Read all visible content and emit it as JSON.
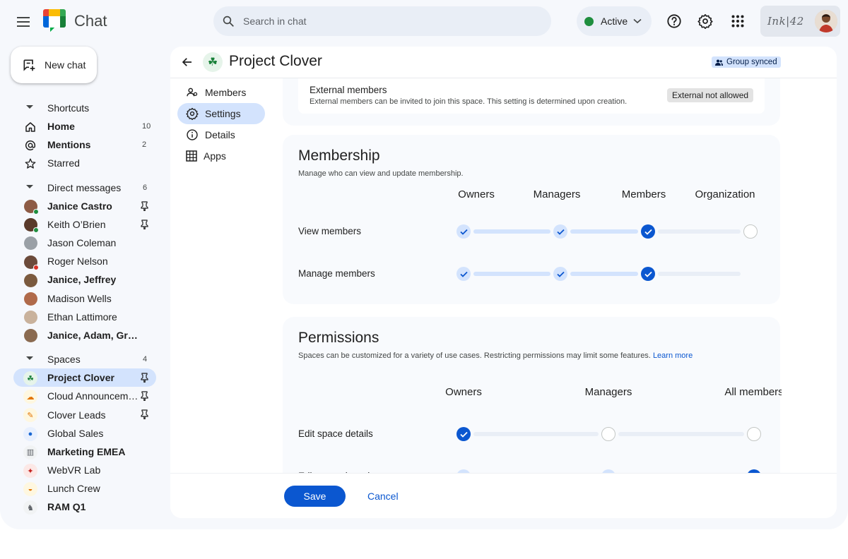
{
  "app": {
    "title": "Chat"
  },
  "search": {
    "placeholder": "Search in chat"
  },
  "status": {
    "label": "Active",
    "color": "#1e8e3e"
  },
  "account": {
    "brand": "Ink|42"
  },
  "new_chat": {
    "label": "New chat"
  },
  "shortcuts": {
    "header": "Shortcuts",
    "items": [
      {
        "label": "Home",
        "count": "10",
        "icon": "home-icon"
      },
      {
        "label": "Mentions",
        "count": "2",
        "icon": "at-icon"
      },
      {
        "label": "Starred",
        "count": "",
        "icon": "star-icon"
      }
    ]
  },
  "direct_messages": {
    "header": "Direct messages",
    "count": "6",
    "items": [
      {
        "label": "Janice Castro",
        "bold": true,
        "pinned": true
      },
      {
        "label": "Keith O’Brien",
        "bold": false,
        "pinned": true
      },
      {
        "label": "Jason Coleman",
        "bold": false,
        "pinned": false
      },
      {
        "label": "Roger Nelson",
        "bold": false,
        "pinned": false
      },
      {
        "label": "Janice, Jeffrey",
        "bold": true,
        "pinned": false
      },
      {
        "label": "Madison Wells",
        "bold": false,
        "pinned": false
      },
      {
        "label": "Ethan Lattimore",
        "bold": false,
        "pinned": false
      },
      {
        "label": "Janice, Adam, Gre...",
        "bold": true,
        "pinned": false
      }
    ]
  },
  "spaces": {
    "header": "Spaces",
    "count": "4",
    "items": [
      {
        "label": "Project Clover",
        "bold": true,
        "pinned": true,
        "active": true,
        "emoji": "☘"
      },
      {
        "label": "Cloud Announceme...",
        "bold": false,
        "pinned": true,
        "emoji": "☁"
      },
      {
        "label": "Clover Leads",
        "bold": false,
        "pinned": true,
        "emoji": "✎"
      },
      {
        "label": "Global Sales",
        "bold": false,
        "pinned": false,
        "emoji": "●"
      },
      {
        "label": "Marketing EMEA",
        "bold": true,
        "pinned": false,
        "emoji": "▥"
      },
      {
        "label": "WebVR Lab",
        "bold": false,
        "pinned": false,
        "emoji": "✦"
      },
      {
        "label": "Lunch Crew",
        "bold": false,
        "pinned": false,
        "emoji": "◒"
      },
      {
        "label": "RAM Q1",
        "bold": true,
        "pinned": false,
        "emoji": "♞"
      }
    ]
  },
  "space": {
    "title": "Project Clover",
    "synced_label": "Group synced"
  },
  "subnav": [
    {
      "label": "Members",
      "icon": "members-icon",
      "active": false
    },
    {
      "label": "Settings",
      "icon": "settings-icon",
      "active": true
    },
    {
      "label": "Details",
      "icon": "info-icon",
      "active": false
    },
    {
      "label": "Apps",
      "icon": "apps-grid-icon",
      "active": false
    }
  ],
  "external": {
    "title": "External members",
    "description": "External members can be invited to join this space. This setting is determined upon creation.",
    "chip": "External not allowed"
  },
  "membership": {
    "title": "Membership",
    "description": "Manage who can view and update membership.",
    "columns": [
      "Owners",
      "Managers",
      "Members",
      "Organization"
    ],
    "rows": [
      {
        "label": "View members",
        "level": 3
      },
      {
        "label": "Manage members",
        "level": 3
      }
    ]
  },
  "permissions": {
    "title": "Permissions",
    "description": "Spaces can be customized for a variety of use cases. Restricting permissions may limit some features.",
    "learn_more": "Learn more",
    "columns": [
      "Owners",
      "Managers",
      "All members"
    ],
    "rows": [
      {
        "label": "Edit space details",
        "level": 1
      },
      {
        "label": "Edit space board",
        "level": 3
      }
    ]
  },
  "footer": {
    "save": "Save",
    "cancel": "Cancel"
  },
  "colors": {
    "accent": "#0b57d0",
    "accent_light": "#d3e3fd",
    "sidebar_bg": "#f6f8fc"
  }
}
